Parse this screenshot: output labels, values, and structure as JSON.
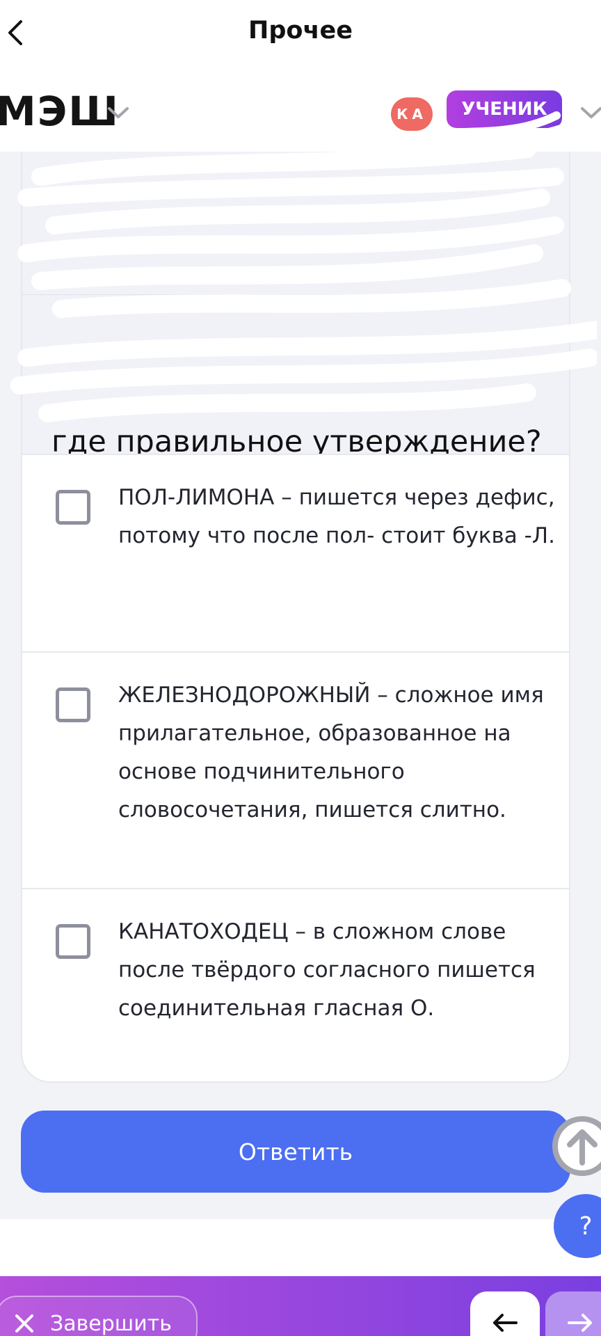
{
  "nav": {
    "title": "Прочее"
  },
  "header": {
    "logo": "МЭШ",
    "avatar_initials": "КА",
    "role": "УЧЕНИК"
  },
  "question": {
    "text": "где правильное утверждение?"
  },
  "options": [
    {
      "text": "ПОЛ-ЛИМОНА – пишется через дефис, потому что после пол- стоит буква -Л.",
      "checked": false
    },
    {
      "text": "ЖЕЛЕЗНОДОРОЖНЫЙ – сложное имя прилагательное, образованное на основе подчинительного словосочетания, пишется слитно.",
      "checked": false
    },
    {
      "text": "КАНАТОХОДЕЦ – в сложном слове после твёрдого согласного пишется соединительная гласная О.",
      "checked": false
    }
  ],
  "actions": {
    "submit": "Ответить",
    "help": "?",
    "finish": "Завершить"
  },
  "icons": [
    "chevron-left-icon",
    "chevron-down-icon",
    "check-icon",
    "arrow-up-icon",
    "close-icon",
    "arrow-left-icon",
    "arrow-right-icon"
  ],
  "colors": {
    "accent": "#4c6ef1",
    "purple_start": "#b23fe0",
    "purple_end": "#7a3be0",
    "avatar": "#ee6a63"
  }
}
